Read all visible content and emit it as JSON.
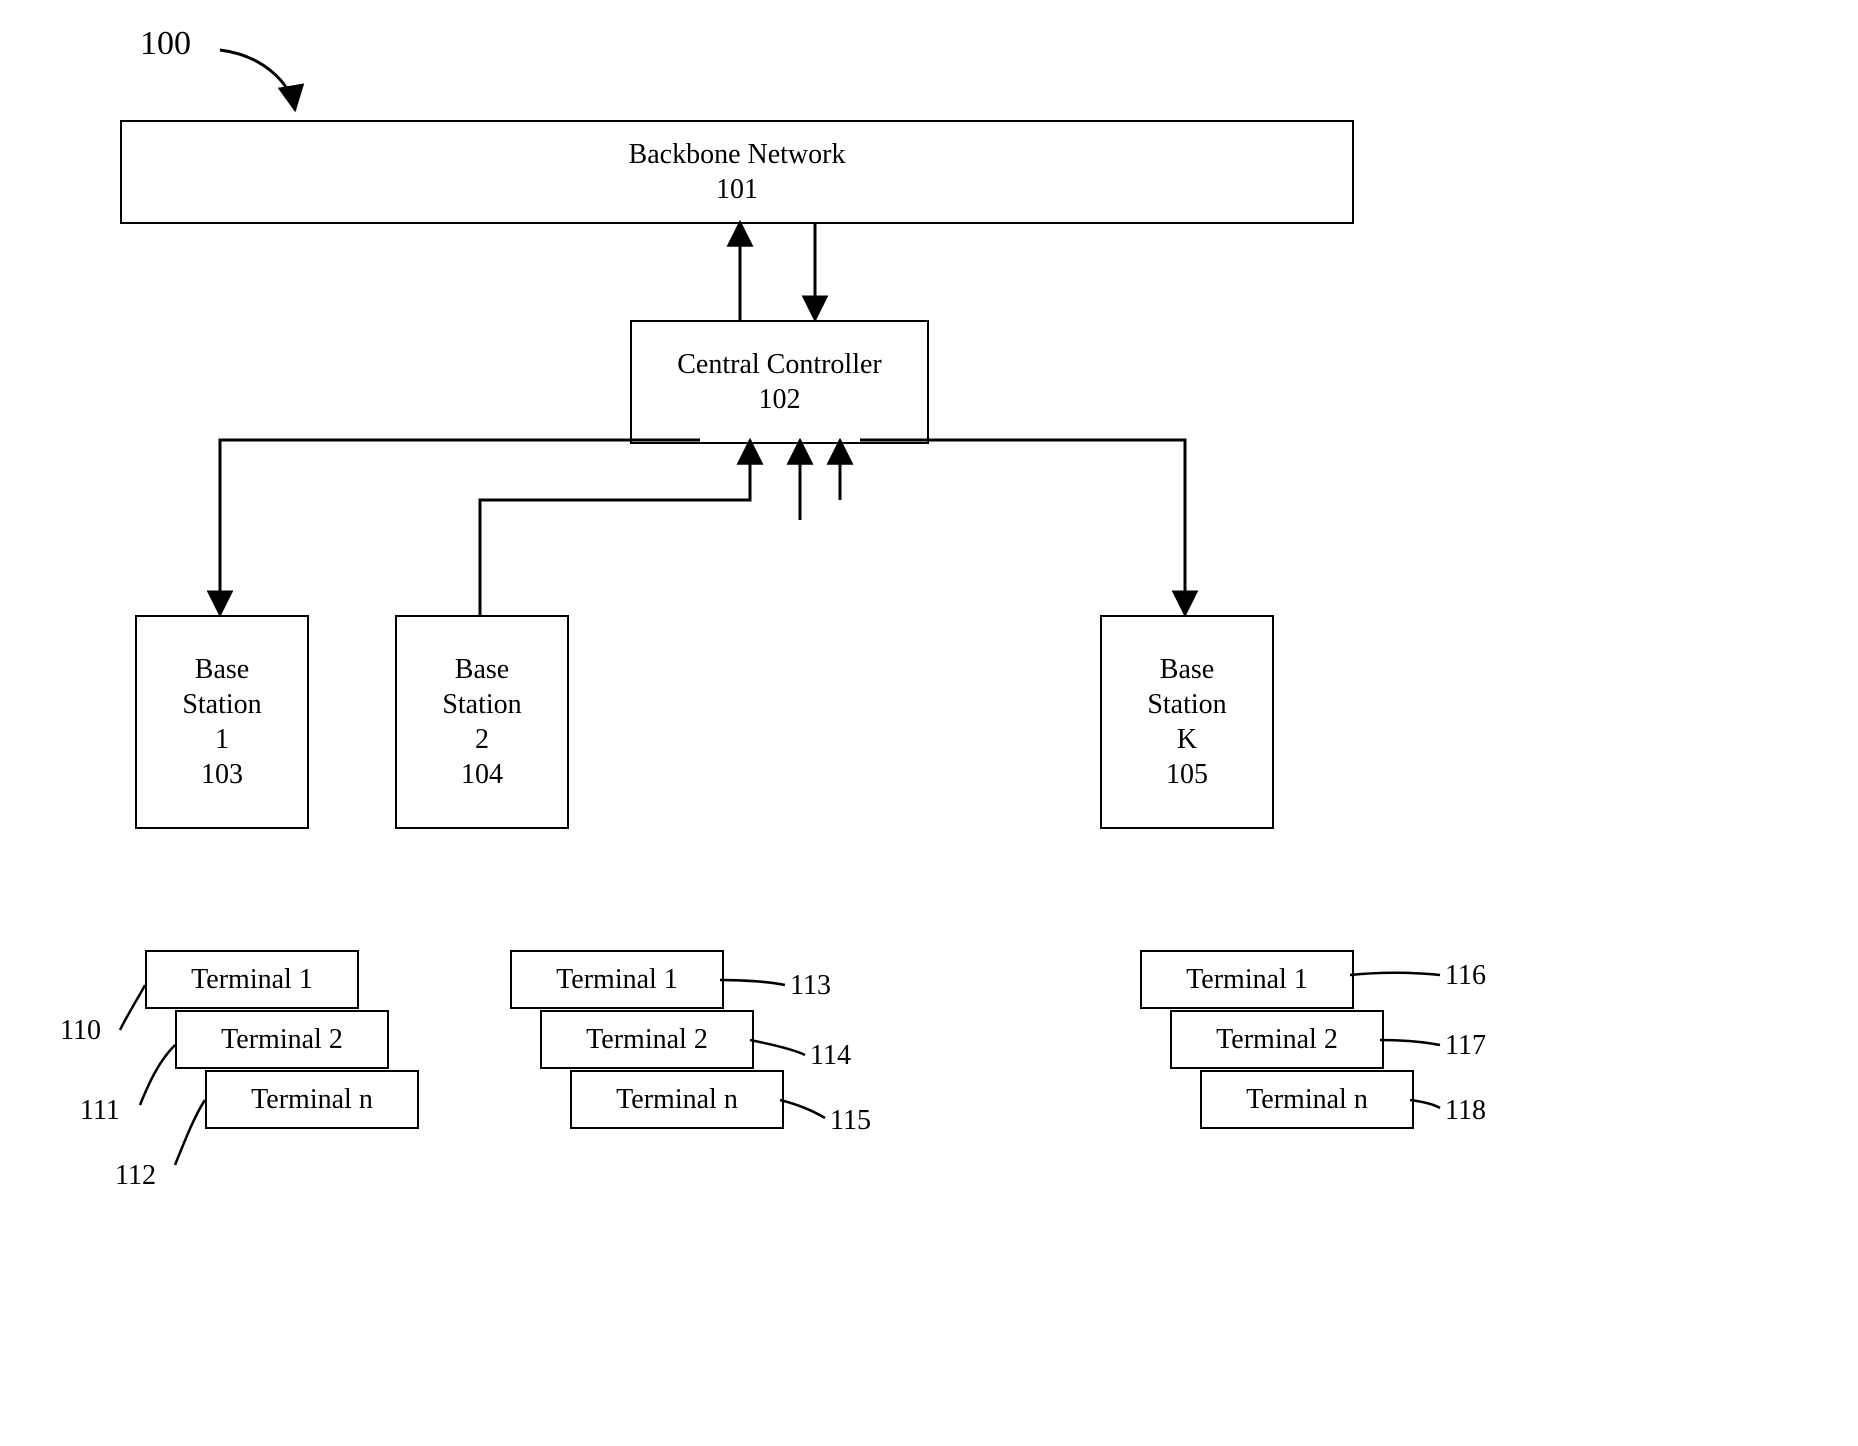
{
  "system_ref": "100",
  "backbone": {
    "title": "Backbone Network",
    "ref": "101"
  },
  "controller": {
    "title": "Central Controller",
    "ref": "102"
  },
  "base_stations": [
    {
      "title": "Base Station",
      "num": "1",
      "ref": "103"
    },
    {
      "title": "Base Station",
      "num": "2",
      "ref": "104"
    },
    {
      "title": "Base Station",
      "num": "K",
      "ref": "105"
    }
  ],
  "terminal_groups": [
    {
      "t1": "Terminal 1",
      "t2": "Terminal 2",
      "tn": "Terminal n",
      "r1": "110",
      "r2": "111",
      "rn": "112"
    },
    {
      "t1": "Terminal 1",
      "t2": "Terminal 2",
      "tn": "Terminal n",
      "r1": "113",
      "r2": "114",
      "rn": "115"
    },
    {
      "t1": "Terminal 1",
      "t2": "Terminal 2",
      "tn": "Terminal n",
      "r1": "116",
      "r2": "117",
      "rn": "118"
    }
  ]
}
